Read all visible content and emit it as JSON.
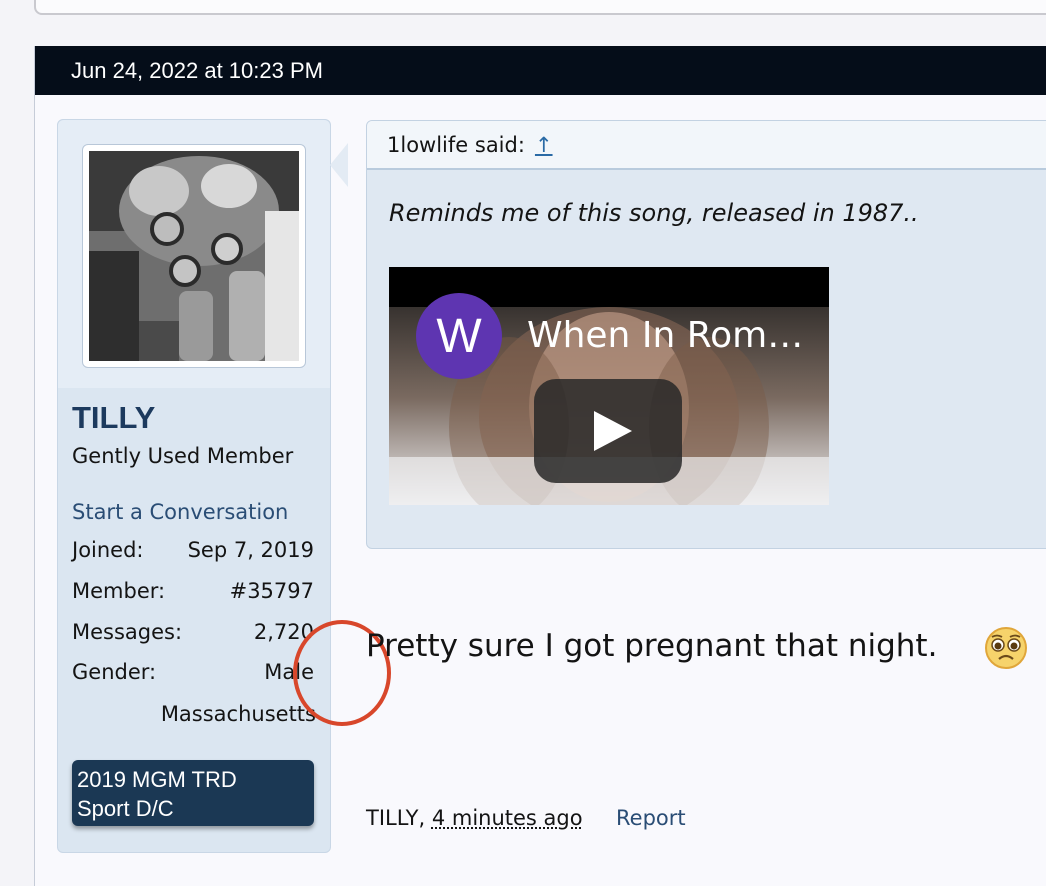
{
  "post": {
    "date": "Jun 24, 2022 at 10:23 PM",
    "message": "Pretty sure I got pregnant that night.",
    "emoji": "pleading-face-emoji"
  },
  "user": {
    "name": "TILLY",
    "title": "Gently Used Member",
    "start_conversation": "Start a Conversation",
    "stats": [
      {
        "label": "Joined:",
        "value": "Sep 7, 2019"
      },
      {
        "label": "Member:",
        "value": "#35797"
      },
      {
        "label": "Messages:",
        "value": "2,720"
      },
      {
        "label": "Gender:",
        "value": "Male"
      }
    ],
    "location": "Massachusetts",
    "banner_line1": "2019 MGM TRD",
    "banner_line2": "Sport D/C"
  },
  "quote": {
    "author": "1lowlife said:",
    "link_glyph": "↑",
    "text": "Reminds me of this song, released in 1987..",
    "video": {
      "channel_initial": "W",
      "title": "When In Rom…"
    }
  },
  "footer": {
    "author": "TILLY,",
    "time": "4 minutes ago",
    "report": "Report"
  },
  "colors": {
    "header_bg": "#050d19",
    "user_panel_bg": "#dbe6f1",
    "username": "#1c3a5e",
    "link": "#2a4d75",
    "banner_bg": "#1b3854",
    "highlight_circle": "#d8472b",
    "channel_avatar": "#5e35b1"
  }
}
